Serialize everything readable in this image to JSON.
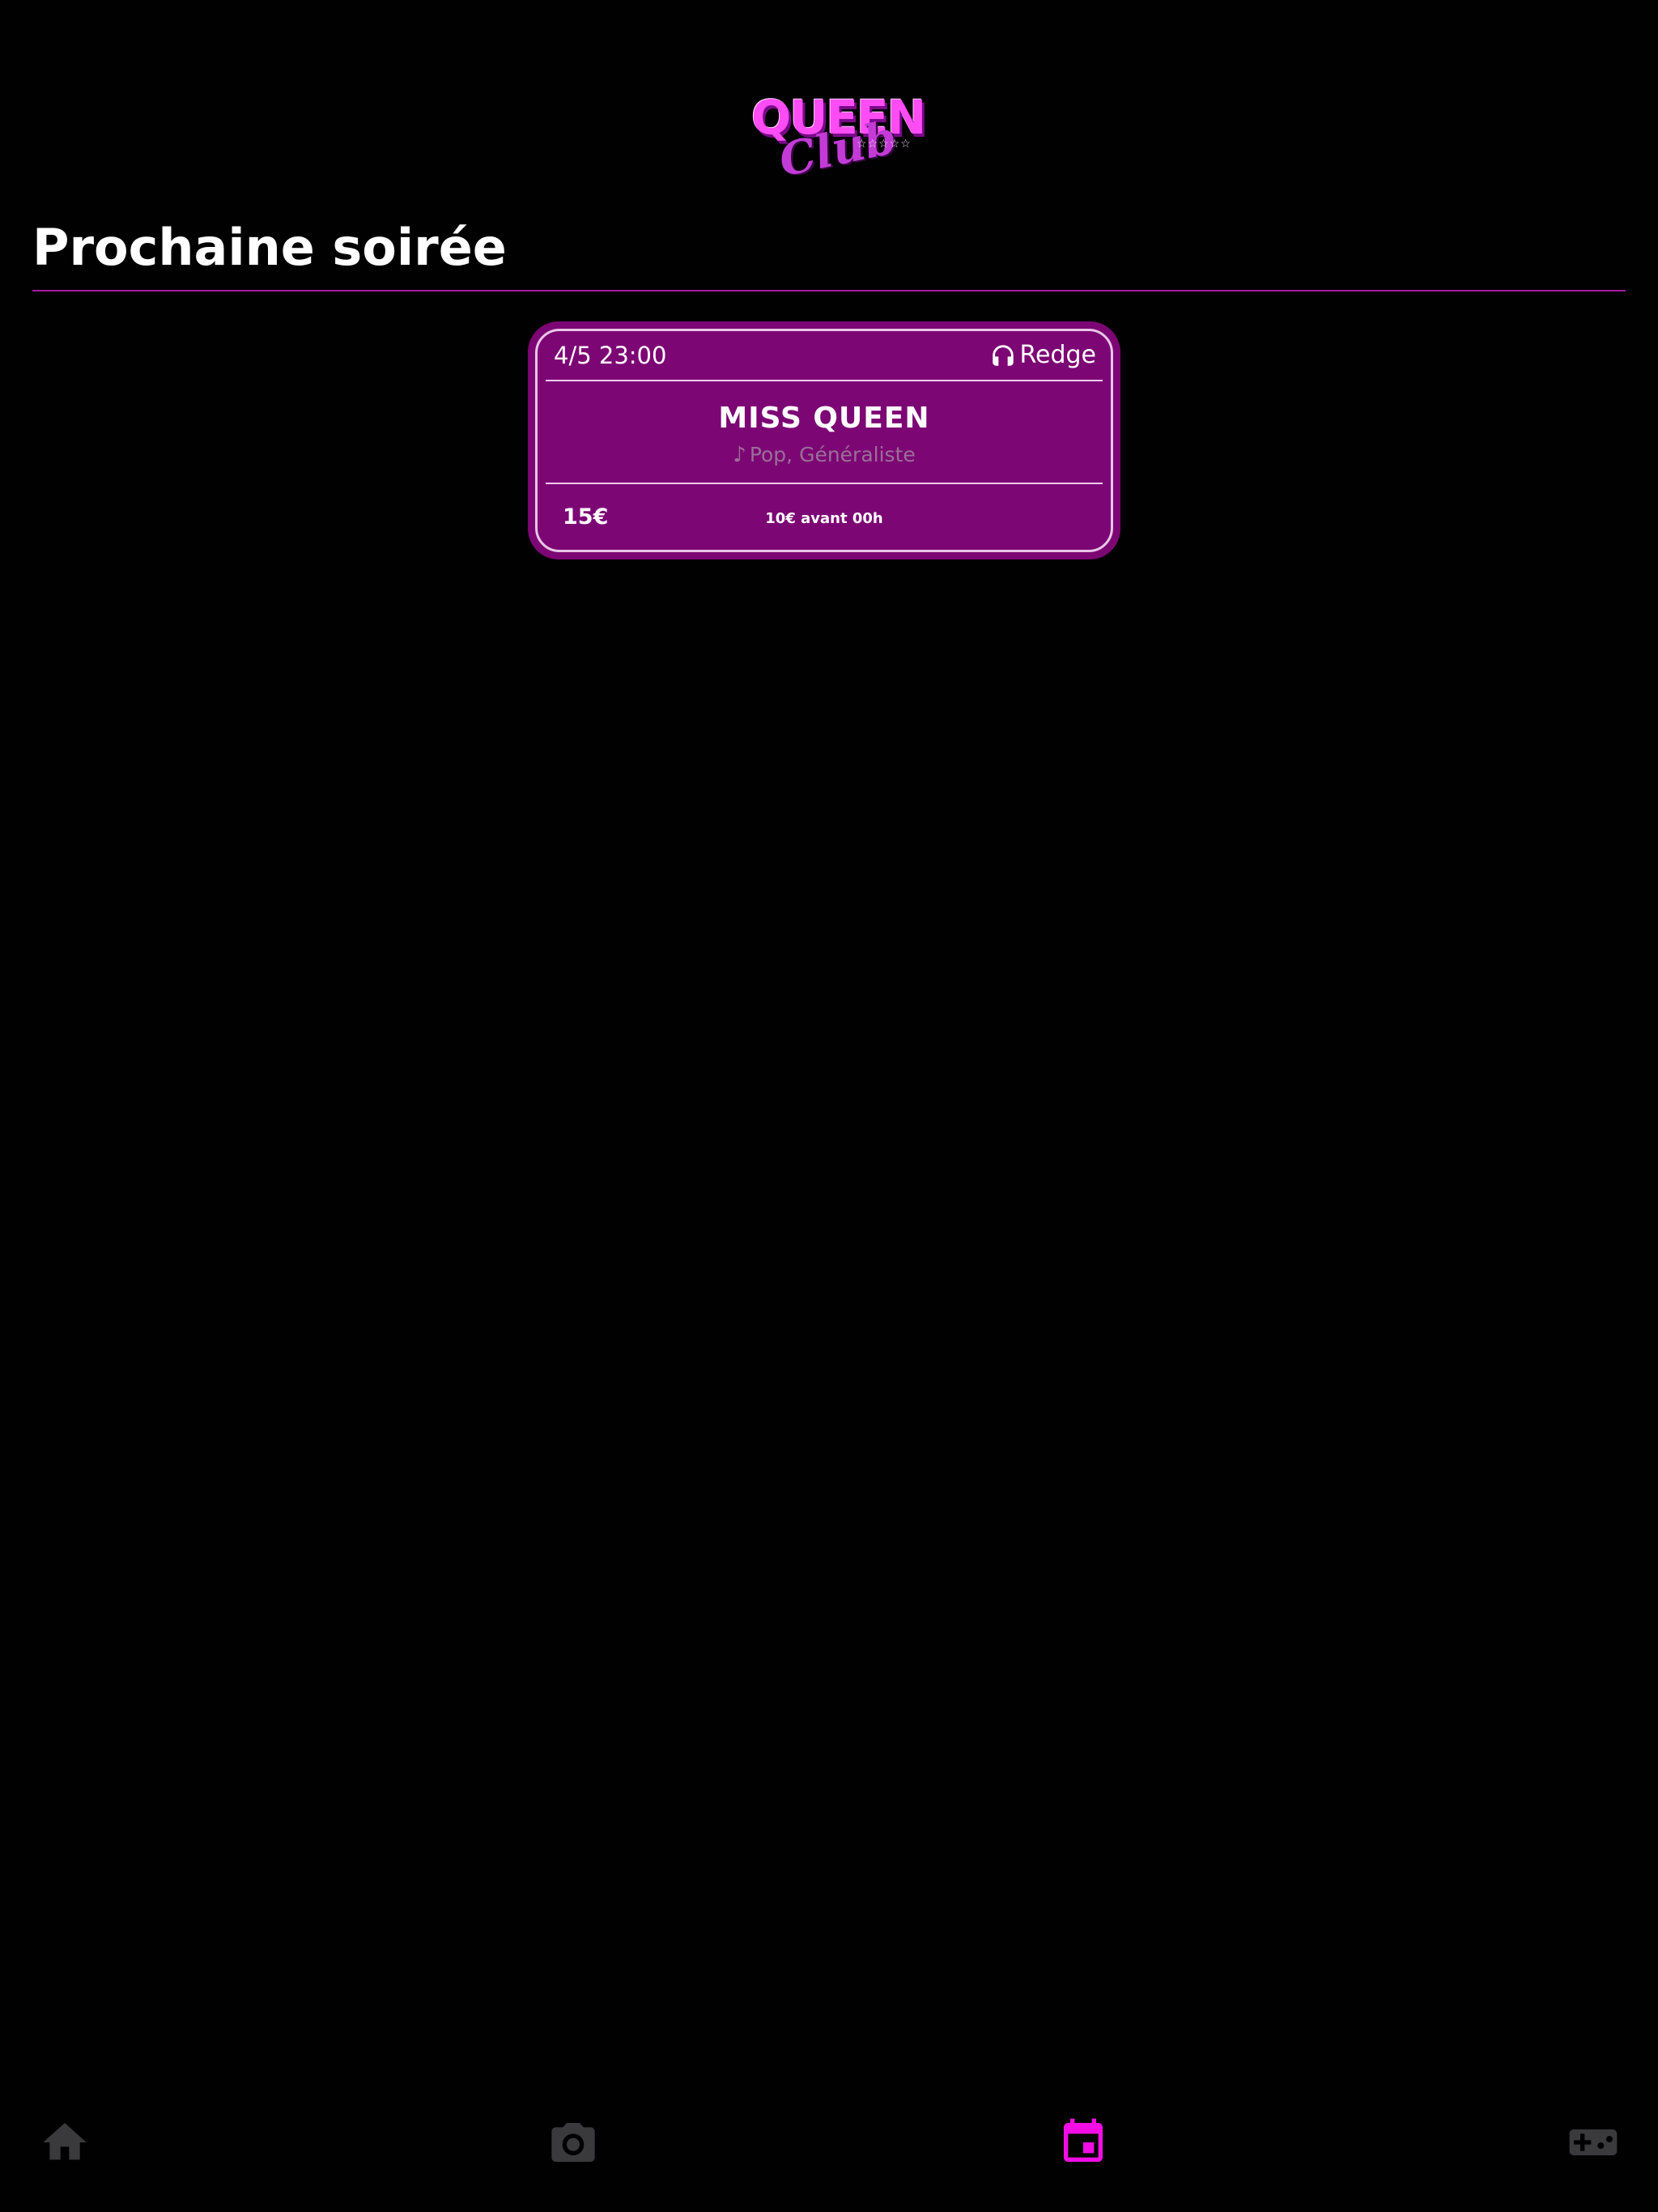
{
  "logo": {
    "top_text": "QUEEN",
    "script_text": "Club",
    "stars": "☆☆☆☆☆"
  },
  "section_title": "Prochaine soirée",
  "event": {
    "date": "4/5 23:00",
    "dj": "Redge",
    "name": "MISS QUEEN",
    "genre": "Pop, Généraliste",
    "price": "15€",
    "promo": "10€ avant 00h"
  },
  "nav": {
    "items": [
      {
        "icon": "home-icon",
        "active": false
      },
      {
        "icon": "camera-icon",
        "active": false
      },
      {
        "icon": "calendar-icon",
        "active": true
      },
      {
        "icon": "gamepad-icon",
        "active": false
      }
    ],
    "active_color": "#f20ee4",
    "inactive_color": "#3a3a3c"
  },
  "colors": {
    "background": "#020102",
    "card": "#7d0675",
    "accent": "#a81aa4"
  }
}
